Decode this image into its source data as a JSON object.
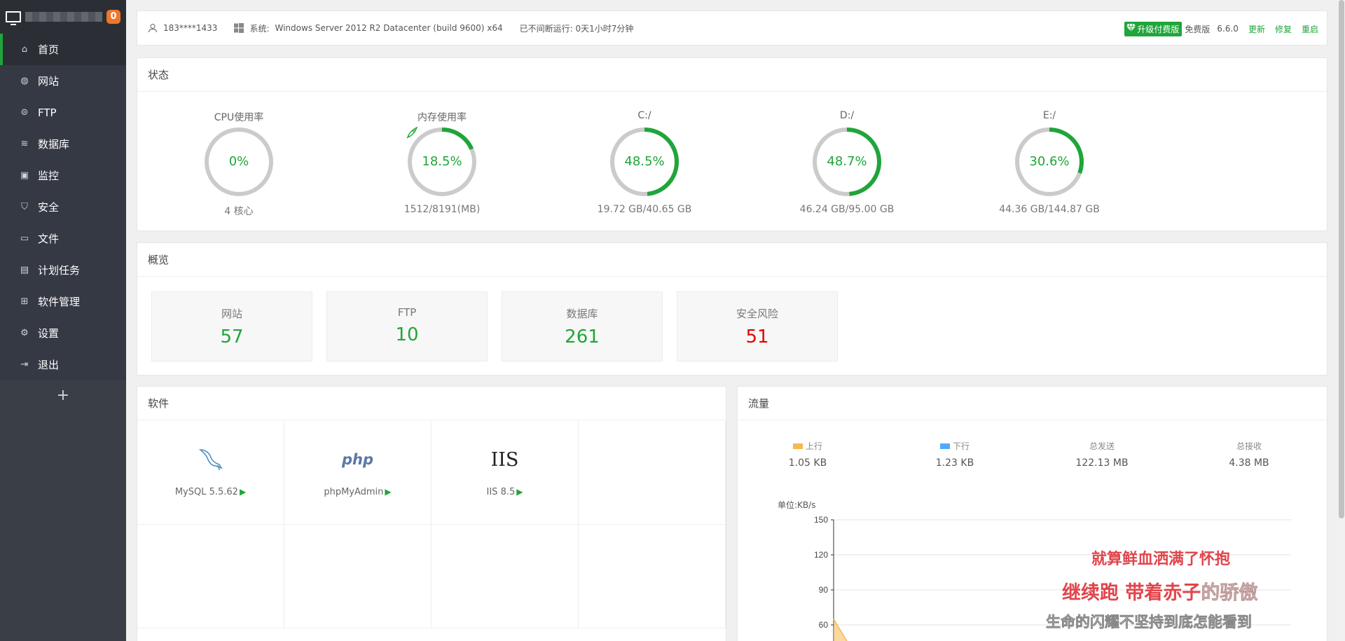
{
  "sidebar": {
    "badge": "0",
    "menu": [
      {
        "label": "首页",
        "icon": "home-icon",
        "glyph": "⌂"
      },
      {
        "label": "网站",
        "icon": "globe-icon",
        "glyph": "◍"
      },
      {
        "label": "FTP",
        "icon": "ftp-icon",
        "glyph": "⊜"
      },
      {
        "label": "数据库",
        "icon": "database-icon",
        "glyph": "≋"
      },
      {
        "label": "监控",
        "icon": "monitor-icon",
        "glyph": "▣"
      },
      {
        "label": "安全",
        "icon": "shield-icon",
        "glyph": "⛉"
      },
      {
        "label": "文件",
        "icon": "folder-icon",
        "glyph": "▭"
      },
      {
        "label": "计划任务",
        "icon": "calendar-icon",
        "glyph": "▤"
      },
      {
        "label": "软件管理",
        "icon": "apps-icon",
        "glyph": "⊞"
      },
      {
        "label": "设置",
        "icon": "gear-icon",
        "glyph": "⚙"
      },
      {
        "label": "退出",
        "icon": "logout-icon",
        "glyph": "⇥"
      }
    ],
    "add": "+"
  },
  "header": {
    "user": "183****1433",
    "os_label": "系统:",
    "os_value": "Windows Server 2012 R2 Datacenter (build 9600) x64",
    "uptime": "已不间断运行: 0天1小时7分钟",
    "upgrade": "升级付费版",
    "edition": "免费版",
    "version": "6.6.0",
    "update": "更新",
    "repair": "修复",
    "restart": "重启"
  },
  "status": {
    "title": "状态",
    "gauges": [
      {
        "label": "CPU使用率",
        "value": "0%",
        "percent": 0,
        "sub": "4 核心"
      },
      {
        "label": "内存使用率",
        "value": "18.5%",
        "percent": 18.5,
        "sub": "1512/8191(MB)"
      },
      {
        "label": "C:/",
        "value": "48.5%",
        "percent": 48.5,
        "sub": "19.72 GB/40.65 GB"
      },
      {
        "label": "D:/",
        "value": "48.7%",
        "percent": 48.7,
        "sub": "46.24 GB/95.00 GB"
      },
      {
        "label": "E:/",
        "value": "30.6%",
        "percent": 30.6,
        "sub": "44.36 GB/144.87 GB"
      }
    ]
  },
  "overview": {
    "title": "概览",
    "cards": [
      {
        "label": "网站",
        "value": "57"
      },
      {
        "label": "FTP",
        "value": "10"
      },
      {
        "label": "数据库",
        "value": "261"
      },
      {
        "label": "安全风险",
        "value": "51"
      }
    ]
  },
  "software": {
    "title": "软件",
    "items": [
      {
        "name": "MySQL 5.5.62",
        "icon": "mysql-dolphin-icon"
      },
      {
        "name": "phpMyAdmin",
        "icon": "php-logo-icon",
        "logo": "php"
      },
      {
        "name": "IIS 8.5",
        "icon": "iis-logo-icon",
        "logo": "IIS"
      }
    ]
  },
  "traffic": {
    "title": "流量",
    "up_label": "上行",
    "up_value": "1.05 KB",
    "down_label": "下行",
    "down_value": "1.23 KB",
    "sent_label": "总发送",
    "sent_value": "122.13 MB",
    "recv_label": "总接收",
    "recv_value": "4.38 MB",
    "unit": "单位:KB/s",
    "colors": {
      "up": "#f7b851",
      "down": "#52a9ff"
    },
    "lyrics": {
      "line1": "就算鲜血洒满了怀抱",
      "line2a": "继续跑 带着赤子",
      "line2b": "的骄傲",
      "line3": "生命的闪耀不坚持到底怎能看到"
    }
  },
  "chart_data": {
    "type": "area",
    "ylabel": "单位:KB/s",
    "ylim": [
      0,
      150
    ],
    "yticks": [
      60,
      90,
      120,
      150
    ],
    "series": [
      {
        "name": "上行",
        "values": [
          65,
          45
        ]
      }
    ]
  }
}
